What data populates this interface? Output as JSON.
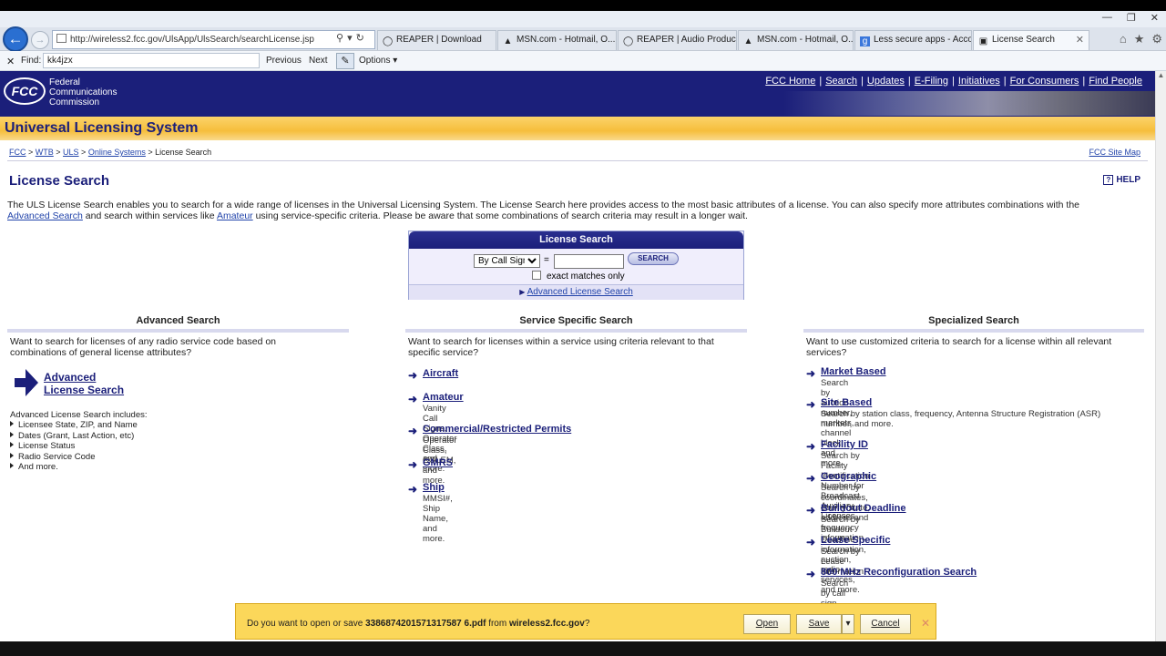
{
  "browser": {
    "url": "http://wireless2.fcc.gov/UlsApp/UlsSearch/searchLicense.jsp",
    "tabs": [
      {
        "label": "REAPER | Download",
        "icon": "shield-icon"
      },
      {
        "label": "MSN.com - Hotmail, O...",
        "icon": "msn-icon"
      },
      {
        "label": "REAPER | Audio Produc...",
        "icon": "shield-icon"
      },
      {
        "label": "MSN.com - Hotmail, O...",
        "icon": "msn-icon"
      },
      {
        "label": "Less secure apps - Acco...",
        "icon": "google-icon"
      },
      {
        "label": "License Search",
        "icon": "page-icon"
      }
    ],
    "find": {
      "label": "Find:",
      "value": "kk4jzx",
      "previous": "Previous",
      "next": "Next",
      "options": "Options"
    }
  },
  "fcc": {
    "logo_text": "FCC",
    "name": [
      "Federal",
      "Communications",
      "Commission"
    ],
    "nav": [
      "FCC Home",
      "Search",
      "Updates",
      "E-Filing",
      "Initiatives",
      "For Consumers",
      "Find People"
    ],
    "system_title": "Universal Licensing System"
  },
  "breadcrumb": {
    "items": [
      "FCC",
      "WTB",
      "ULS",
      "Online Systems"
    ],
    "current": "License Search",
    "sitemap": "FCC Site Map"
  },
  "page": {
    "title": "License Search",
    "help": "HELP",
    "intro_1": "The ULS License Search enables you to search for a wide range of licenses in the Universal Licensing System. The License Search here provides access to the most basic attributes of a license. You can also specify more attributes combinations with the",
    "intro_link1": "Advanced Search",
    "intro_2": " and search within services like ",
    "intro_link2": "Amateur",
    "intro_3": " using service-specific criteria. Please be aware that some combinations of search criteria may result in a longer wait."
  },
  "search_box": {
    "header": "License Search",
    "select_value": "By Call Sign",
    "equals": "=",
    "button": "SEARCH",
    "exact_label": "exact matches only",
    "advanced_link": "Advanced License Search"
  },
  "advanced": {
    "heading": "Advanced Search",
    "desc": "Want to search for licenses of any radio service code based on combinations of general license attributes?",
    "link_line1": "Advanced",
    "link_line2": "License Search",
    "includes_label": "Advanced License Search includes:",
    "includes": [
      "Licensee State, ZIP, and Name",
      "Dates (Grant, Last Action, etc)",
      "License Status",
      "Radio Service Code",
      "And more."
    ]
  },
  "service": {
    "heading": "Service Specific Search",
    "desc": "Want to search for licenses within a service using criteria relevant to that specific service?",
    "items": [
      {
        "label": "Aircraft",
        "sub": ""
      },
      {
        "label": "Amateur",
        "sub": "Vanity Call Signs, Operator Class, and more."
      },
      {
        "label": "Commercial/Restricted Permits",
        "sub": "Operator Class, COLEM, and more."
      },
      {
        "label": "GMRS",
        "sub": ""
      },
      {
        "label": "Ship",
        "sub": "MMSI#, Ship Name, and more."
      }
    ]
  },
  "specialized": {
    "heading": "Specialized Search",
    "desc": "Want to use customized criteria to search for a license within all relevant services?",
    "items": [
      {
        "label": "Market Based",
        "sub": "Search by auction number, markets, channel block and more."
      },
      {
        "label": "Site Based",
        "sub": "Search by station class, frequency, Antenna Structure Registration (ASR) number, and more."
      },
      {
        "label": "Facility ID",
        "sub": "Search by Facility Identification Number for Broadcast Auxiliary Licenses."
      },
      {
        "label": "Geographic",
        "sub": "Search by coordinates, county/state, address and frequency information."
      },
      {
        "label": "Buildout Deadline",
        "sub": "Search by Buildout Deadline information, auction, radio services, and more."
      },
      {
        "label": "Lease Specific",
        "sub": "Search by Lease information."
      },
      {
        "label": "800 MHz Reconfiguration Search",
        "sub": "Search by call sign, NPSPAC region, frequency range, and more."
      }
    ]
  },
  "download": {
    "prefix": "Do you want to open or save ",
    "filename": "3386874201571317587 6.pdf",
    "middle": " from ",
    "site": "wireless2.fcc.gov",
    "suffix": "?",
    "open": "Open",
    "save": "Save",
    "cancel": "Cancel"
  }
}
